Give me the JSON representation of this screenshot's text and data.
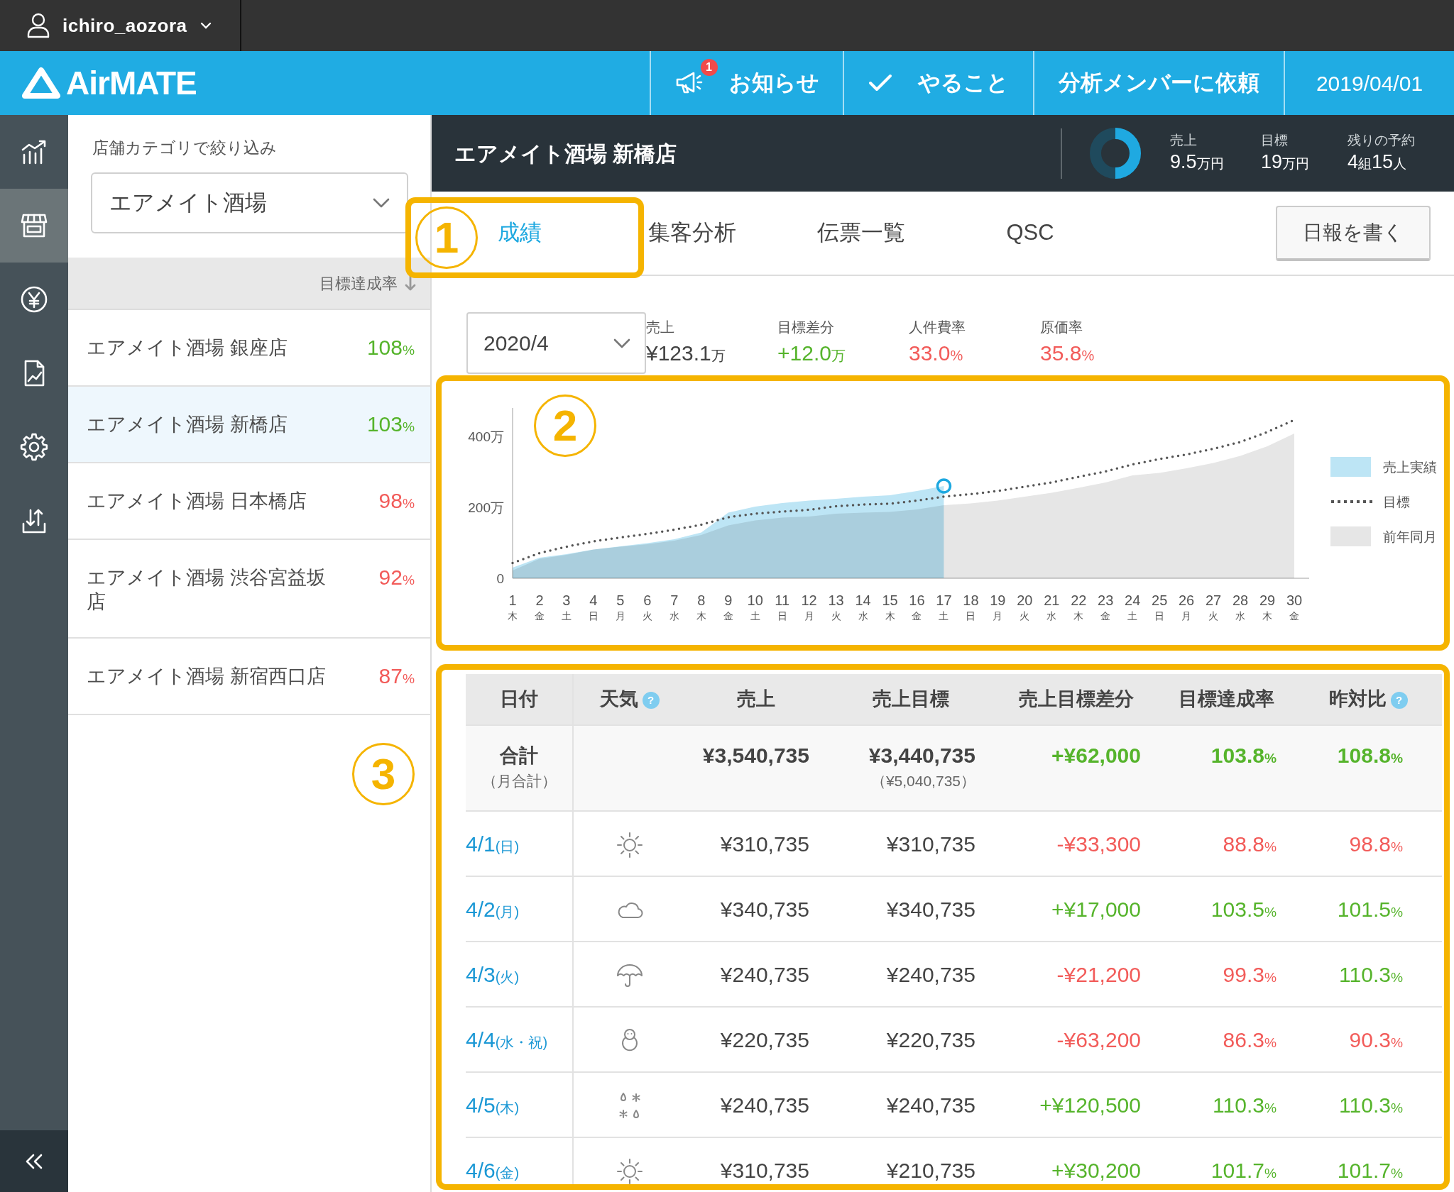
{
  "account_bar": {
    "username": "ichiro_aozora"
  },
  "header": {
    "logo": "AirMATE",
    "actions": [
      {
        "kind": "notice",
        "label": "お知らせ",
        "badge": "1"
      },
      {
        "kind": "todo",
        "label": "やること"
      },
      {
        "kind": "request",
        "label": "分析メンバーに依頼"
      }
    ],
    "date": "2019/04/01"
  },
  "nav_rail": {
    "items": [
      {
        "kind": "analytics",
        "selected": false
      },
      {
        "kind": "store",
        "selected": true
      },
      {
        "kind": "money",
        "selected": false
      },
      {
        "kind": "report",
        "selected": false
      },
      {
        "kind": "settings",
        "selected": false
      },
      {
        "kind": "export",
        "selected": false
      }
    ]
  },
  "store_panel": {
    "filter_label": "店舗カテゴリで絞り込み",
    "filter_value": "エアメイト酒場",
    "sort_label": "目標達成率",
    "stores": [
      {
        "name": "エアメイト酒場 銀座店",
        "value": "108",
        "unit": "%",
        "color": "#56b42c",
        "selected": false
      },
      {
        "name": "エアメイト酒場 新橋店",
        "value": "103",
        "unit": "%",
        "color": "#56b42c",
        "selected": true
      },
      {
        "name": "エアメイト酒場 日本橋店",
        "value": "98",
        "unit": "%",
        "color": "#f25c5a",
        "selected": false
      },
      {
        "name": "エアメイト酒場 渋谷宮益坂店",
        "value": "92",
        "unit": "%",
        "color": "#f25c5a",
        "selected": false
      },
      {
        "name": "エアメイト酒場 新宿西口店",
        "value": "87",
        "unit": "%",
        "color": "#f25c5a",
        "selected": false
      }
    ]
  },
  "store_header": {
    "title": "エアメイト酒場 新橋店",
    "progress": {
      "level": 0.5
    },
    "stats": [
      {
        "label": "売上",
        "parts": [
          "9.5",
          "万円"
        ]
      },
      {
        "label": "目標",
        "parts": [
          "19",
          "万円"
        ]
      },
      {
        "label": "残りの予約",
        "parts": [
          "4",
          "組",
          "15",
          "人"
        ]
      }
    ]
  },
  "tabs": [
    {
      "label": "成績",
      "selected": true
    },
    {
      "label": "集客分析",
      "selected": false
    },
    {
      "label": "伝票一覧",
      "selected": false
    },
    {
      "label": "QSC",
      "selected": false
    }
  ],
  "write_report_button": "日報を書く",
  "month_select": "2020/4",
  "summary": [
    {
      "label": "売上",
      "parts": [
        "¥123.1",
        "万"
      ],
      "color": "#444444"
    },
    {
      "label": "目標差分",
      "parts": [
        "+12.0",
        "万"
      ],
      "color": "#56b42c"
    },
    {
      "label": "人件費率",
      "parts": [
        "33.0",
        "%"
      ],
      "color": "#f25c5a"
    },
    {
      "label": "原価率",
      "parts": [
        "35.8",
        "%"
      ],
      "color": "#f25c5a"
    }
  ],
  "chart": {
    "chart_data": {
      "type": "area",
      "categories": [
        "1\n木",
        "2\n金",
        "3\n土",
        "4\n日",
        "5\n月",
        "6\n火",
        "7\n水",
        "8\n木",
        "9\n金",
        "10\n土",
        "11\n日",
        "12\n月",
        "13\n火",
        "14\n水",
        "15\n木",
        "16\n金",
        "17\n土",
        "18\n日",
        "19\n月",
        "20\n火",
        "21\n水",
        "22\n木",
        "23\n金",
        "24\n土",
        "25\n日",
        "26\n月",
        "27\n火",
        "28\n水",
        "29\n木",
        "30\n金"
      ],
      "ylim": [
        0,
        480
      ],
      "yticks": [
        {
          "value": 0,
          "label": "0"
        },
        {
          "value": 200,
          "label": "200万"
        },
        {
          "value": 400,
          "label": "400万"
        }
      ],
      "legend": true,
      "series": [
        {
          "name": "売上実績",
          "type": "area",
          "color": "#bde5f5",
          "values": [
            30,
            58,
            68,
            81,
            90,
            99,
            110,
            129,
            185,
            202,
            212,
            219,
            224,
            230,
            234,
            246,
            260,
            null,
            null,
            null,
            null,
            null,
            null,
            null,
            null,
            null,
            null,
            null,
            null,
            null
          ]
        },
        {
          "name": "目標",
          "type": "line",
          "line_style": "dotted",
          "color": "#555555",
          "values": [
            43,
            71,
            89,
            104,
            115,
            125,
            137,
            151,
            172,
            182,
            188,
            193,
            203,
            208,
            210,
            219,
            230,
            237,
            246,
            258,
            270,
            286,
            301,
            321,
            336,
            349,
            365,
            384,
            412,
            446
          ]
        },
        {
          "name": "前年同月",
          "type": "area",
          "color": "#e6e6e6",
          "values": [
            22,
            55,
            66,
            81,
            89,
            96,
            106,
            122,
            149,
            163,
            171,
            174,
            182,
            185,
            187,
            194,
            206,
            211,
            219,
            230,
            241,
            255,
            270,
            290,
            297,
            310,
            325,
            345,
            372,
            408
          ]
        }
      ]
    }
  },
  "table": {
    "columns": [
      {
        "label": "日付"
      },
      {
        "label": "天気",
        "help_icon": "?"
      },
      {
        "label": "売上"
      },
      {
        "label": "売上目標"
      },
      {
        "label": "売上目標差分"
      },
      {
        "label": "目標達成率"
      },
      {
        "label": "昨対比",
        "help_icon": "?"
      }
    ],
    "total": {
      "label": "合計",
      "note": "（月合計）",
      "sales": "¥3,540,735",
      "target": "¥3,440,735",
      "target_note": "（¥5,040,735）",
      "diff": {
        "text": "+¥62,000",
        "color": "#56b42c"
      },
      "rate": {
        "value": "103.8",
        "unit": "%",
        "color": "#56b42c"
      },
      "yoy": {
        "value": "108.8",
        "unit": "%",
        "color": "#56b42c"
      }
    },
    "rows": [
      {
        "date": "4/1",
        "day": "(日)",
        "weather": {
          "kind": "sunny"
        },
        "sales": "¥310,735",
        "target": "¥310,735",
        "diff": {
          "text": "-¥33,300",
          "color": "#f25c5a"
        },
        "rate": {
          "value": "88.8",
          "unit": "%",
          "color": "#f25c5a"
        },
        "yoy": {
          "value": "98.8",
          "unit": "%",
          "color": "#f25c5a"
        }
      },
      {
        "date": "4/2",
        "day": "(月)",
        "weather": {
          "kind": "cloudy"
        },
        "sales": "¥340,735",
        "target": "¥340,735",
        "diff": {
          "text": "+¥17,000",
          "color": "#56b42c"
        },
        "rate": {
          "value": "103.5",
          "unit": "%",
          "color": "#56b42c"
        },
        "yoy": {
          "value": "101.5",
          "unit": "%",
          "color": "#56b42c"
        }
      },
      {
        "date": "4/3",
        "day": "(火)",
        "weather": {
          "kind": "rain"
        },
        "sales": "¥240,735",
        "target": "¥240,735",
        "diff": {
          "text": "-¥21,200",
          "color": "#f25c5a"
        },
        "rate": {
          "value": "99.3",
          "unit": "%",
          "color": "#f25c5a"
        },
        "yoy": {
          "value": "110.3",
          "unit": "%",
          "color": "#56b42c"
        }
      },
      {
        "date": "4/4",
        "day": "(水・祝)",
        "weather": {
          "kind": "snow"
        },
        "sales": "¥220,735",
        "target": "¥220,735",
        "diff": {
          "text": "-¥63,200",
          "color": "#f25c5a"
        },
        "rate": {
          "value": "86.3",
          "unit": "%",
          "color": "#f25c5a"
        },
        "yoy": {
          "value": "90.3",
          "unit": "%",
          "color": "#f25c5a"
        }
      },
      {
        "date": "4/5",
        "day": "(木)",
        "weather": {
          "kind": "sleet"
        },
        "sales": "¥240,735",
        "target": "¥240,735",
        "diff": {
          "text": "+¥120,500",
          "color": "#56b42c"
        },
        "rate": {
          "value": "110.3",
          "unit": "%",
          "color": "#56b42c"
        },
        "yoy": {
          "value": "110.3",
          "unit": "%",
          "color": "#56b42c"
        }
      },
      {
        "date": "4/6",
        "day": "(金)",
        "weather": {
          "kind": "sunny"
        },
        "sales": "¥310,735",
        "target": "¥210,735",
        "diff": {
          "text": "+¥30,200",
          "color": "#56b42c"
        },
        "rate": {
          "value": "101.7",
          "unit": "%",
          "color": "#56b42c"
        },
        "yoy": {
          "value": "101.7",
          "unit": "%",
          "color": "#56b42c"
        }
      }
    ]
  },
  "annotations": [
    {
      "kind": "tab",
      "label": "1"
    },
    {
      "kind": "chart",
      "label": "2"
    },
    {
      "kind": "table",
      "label": "3"
    }
  ]
}
